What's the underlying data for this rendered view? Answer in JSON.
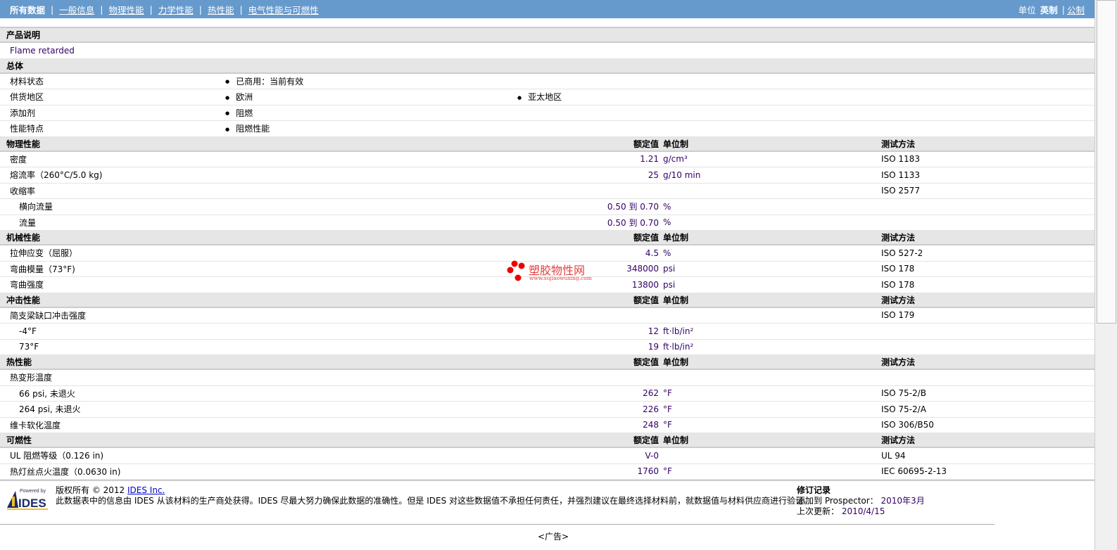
{
  "nav": {
    "tabs": [
      "所有数据",
      "一般信息",
      "物理性能",
      "力学性能",
      "热性能",
      "电气性能与可燃性"
    ],
    "units_label": "单位",
    "unit_active": "英制",
    "unit_other": "公制"
  },
  "headers": {
    "value": "额定值",
    "unit": "单位制",
    "method": "测试方法"
  },
  "description": {
    "title": "产品说明",
    "text": "Flame retarded"
  },
  "general": {
    "title": "总体",
    "rows": [
      {
        "label": "材料状态",
        "items": [
          "已商用：当前有效"
        ]
      },
      {
        "label": "供货地区",
        "items": [
          "欧洲",
          "亚太地区"
        ]
      },
      {
        "label": "添加剂",
        "items": [
          "阻燃"
        ]
      },
      {
        "label": "性能特点",
        "items": [
          "阻燃性能"
        ]
      }
    ]
  },
  "sections": [
    {
      "title": "物理性能",
      "rows": [
        {
          "label": "密度",
          "value": "1.21",
          "unit": "g/cm³",
          "method": "ISO 1183"
        },
        {
          "label": "熔流率（260°C/5.0 kg)",
          "value": "25",
          "unit": "g/10 min",
          "method": "ISO 1133"
        },
        {
          "label": "收缩率",
          "value": "",
          "unit": "",
          "method": "ISO 2577"
        },
        {
          "label": "横向流量",
          "indent": true,
          "value": "0.50 到  0.70",
          "unit": "%",
          "method": ""
        },
        {
          "label": "流量",
          "indent": true,
          "value": "0.50 到  0.70",
          "unit": "%",
          "method": ""
        }
      ]
    },
    {
      "title": "机械性能",
      "rows": [
        {
          "label": "拉伸应变（屈服）",
          "value": "4.5",
          "unit": "%",
          "method": "ISO 527-2"
        },
        {
          "label": "弯曲模量（73°F)",
          "value": "348000",
          "unit": "psi",
          "method": "ISO 178"
        },
        {
          "label": "弯曲强度",
          "value": "13800",
          "unit": "psi",
          "method": "ISO 178"
        }
      ]
    },
    {
      "title": "冲击性能",
      "rows": [
        {
          "label": "简支梁缺口冲击强度",
          "value": "",
          "unit": "",
          "method": "ISO 179"
        },
        {
          "label": "-4°F",
          "indent": true,
          "value": "12",
          "unit": "ft·lb/in²",
          "method": ""
        },
        {
          "label": "73°F",
          "indent": true,
          "value": "19",
          "unit": "ft·lb/in²",
          "method": ""
        }
      ]
    },
    {
      "title": "热性能",
      "rows": [
        {
          "label": "热变形温度",
          "value": "",
          "unit": "",
          "method": ""
        },
        {
          "label": "66 psi, 未退火",
          "indent": true,
          "value": "262",
          "unit": "°F",
          "method": "ISO 75-2/B"
        },
        {
          "label": "264 psi, 未退火",
          "indent": true,
          "value": "226",
          "unit": "°F",
          "method": "ISO 75-2/A"
        },
        {
          "label": "维卡软化温度",
          "value": "248",
          "unit": "°F",
          "method": "ISO 306/B50"
        }
      ]
    },
    {
      "title": "可燃性",
      "rows": [
        {
          "label": "UL 阻燃等级（0.126 in)",
          "value": "V-0",
          "unit": "",
          "method": "UL 94"
        },
        {
          "label": "热灯丝点火温度（0.0630 in)",
          "value": "1760",
          "unit": "°F",
          "method": "IEC 60695-2-13"
        }
      ]
    }
  ],
  "footer": {
    "logo_text": "Powered by IDES",
    "copyright": "版权所有  © 2012 ",
    "company_link": "IDES Inc.",
    "disclaimer": "此数据表中的信息由  IDES 从该材料的生产商处获得。IDES 尽最大努力确保此数据的准确性。但是  IDES 对这些数据值不承担任何责任，并强烈建议在最终选择材料前，就数据值与材料供应商进行验证。",
    "revision_title": "修订记录",
    "added_label": "添加到  Prospector：",
    "added_value": "2010年3月",
    "updated_label": "上次更新：",
    "updated_value": "2010/4/15"
  },
  "watermark": {
    "text": "塑胶物性网",
    "url": "www.sujiaowuxing.com"
  },
  "ad": "<广告>"
}
